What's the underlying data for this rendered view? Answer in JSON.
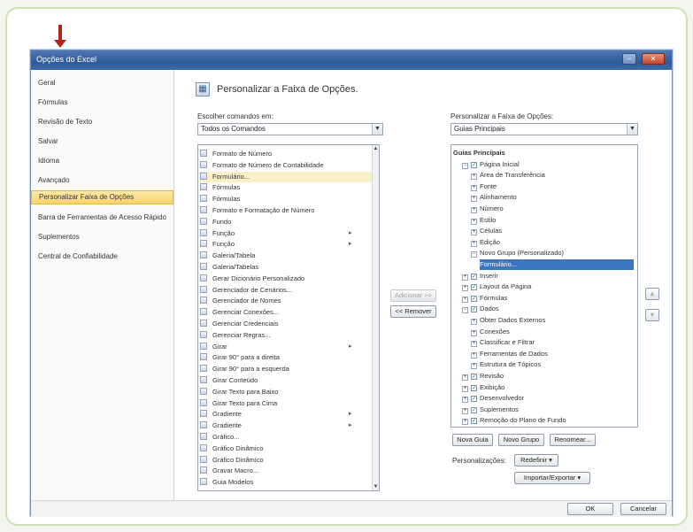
{
  "colors": {
    "frame_border": "#cfe0b4",
    "titlebar": "#2f5a98",
    "selection_highlight": "#fbd36a",
    "tree_selection": "#3c75c2",
    "annotation_arrow": "#b3261e"
  },
  "window": {
    "title": "Opções do Excel",
    "controls": [
      "minimize-icon",
      "maximize-icon",
      "close-icon"
    ]
  },
  "sidebar": {
    "items": [
      {
        "label": "Geral"
      },
      {
        "label": "Fórmulas"
      },
      {
        "label": "Revisão de Texto"
      },
      {
        "label": "Salvar"
      },
      {
        "label": "Idioma"
      },
      {
        "label": "Avançado"
      },
      {
        "label": "Personalizar Faixa de Opções",
        "selected": true
      },
      {
        "label": "Barra de Ferramentas de Acesso Rápido"
      },
      {
        "label": "Suplementos"
      },
      {
        "label": "Central de Confiabilidade"
      }
    ]
  },
  "header": {
    "title": "Personalizar a Faixa de Opções.",
    "icon": "customize-ribbon-icon"
  },
  "left_panel": {
    "choose_label": "Escolher comandos em:",
    "choose_value": "Todos os Comandos",
    "commands": [
      {
        "label": "Formato de Número",
        "sub": ""
      },
      {
        "label": "Formato de Número de Contabilidade",
        "sub": ""
      },
      {
        "label": "Formulário...",
        "selected": true,
        "sub": ""
      },
      {
        "label": "Fórmulas",
        "sub": ""
      },
      {
        "label": "Fórmulas",
        "sub": ""
      },
      {
        "label": "Formato e Formatação de Número",
        "sub": ""
      },
      {
        "label": "Fundo",
        "sub": ""
      },
      {
        "label": "Função",
        "sub": "▸"
      },
      {
        "label": "Função",
        "sub": "▸"
      },
      {
        "label": "Galeria/Tabela",
        "sub": ""
      },
      {
        "label": "Galeria/Tabelas",
        "sub": ""
      },
      {
        "label": "Gerar Dicionário Personalizado",
        "sub": ""
      },
      {
        "label": "Gerenciador de Cenários...",
        "sub": ""
      },
      {
        "label": "Gerenciador de Nomes",
        "sub": ""
      },
      {
        "label": "Gerenciar Conexões...",
        "sub": ""
      },
      {
        "label": "Gerenciar Credenciais",
        "sub": ""
      },
      {
        "label": "Gerenciar Regras...",
        "sub": ""
      },
      {
        "label": "Girar",
        "sub": "▸"
      },
      {
        "label": "Girar 90° para a direita",
        "sub": ""
      },
      {
        "label": "Girar 90° para a esquerda",
        "sub": ""
      },
      {
        "label": "Girar Conteúdo",
        "sub": ""
      },
      {
        "label": "Girar Texto para Baixo",
        "sub": ""
      },
      {
        "label": "Girar Texto para Cima",
        "sub": ""
      },
      {
        "label": "Gradiente",
        "sub": "▸"
      },
      {
        "label": "Gradiente",
        "sub": "▸"
      },
      {
        "label": "Gráfico...",
        "sub": ""
      },
      {
        "label": "Gráfico Dinâmico",
        "sub": ""
      },
      {
        "label": "Gráfico Dinâmico",
        "sub": ""
      },
      {
        "label": "Gravar Macro...",
        "sub": ""
      },
      {
        "label": "Guia Modelos",
        "sub": ""
      }
    ]
  },
  "middle_buttons": {
    "add": "Adicionar >>",
    "remove": "<< Remover"
  },
  "right_panel": {
    "customize_label": "Personalizar a Faixa de Opções:",
    "customize_value": "Guias Principais",
    "tree": [
      {
        "label": "Guias Principais",
        "level": 0,
        "bold": true,
        "toggle": "",
        "checkbox": false
      },
      {
        "label": "Página Inicial",
        "level": 1,
        "toggle": "−",
        "checkbox": true
      },
      {
        "label": "Área de Transferência",
        "level": 2,
        "toggle": "+",
        "checkbox": false
      },
      {
        "label": "Fonte",
        "level": 2,
        "toggle": "+",
        "checkbox": false
      },
      {
        "label": "Alinhamento",
        "level": 2,
        "toggle": "+",
        "checkbox": false
      },
      {
        "label": "Número",
        "level": 2,
        "toggle": "+",
        "checkbox": false
      },
      {
        "label": "Estilo",
        "level": 2,
        "toggle": "+",
        "checkbox": false
      },
      {
        "label": "Células",
        "level": 2,
        "toggle": "+",
        "checkbox": false
      },
      {
        "label": "Edição",
        "level": 2,
        "toggle": "+",
        "checkbox": false
      },
      {
        "label": "Novo Grupo (Personalizado)",
        "level": 2,
        "toggle": "−",
        "checkbox": false
      },
      {
        "label": "Formulário...",
        "level": 3,
        "toggle": "",
        "checkbox": false,
        "selected": true
      },
      {
        "label": "Inserir",
        "level": 1,
        "toggle": "+",
        "checkbox": true
      },
      {
        "label": "Layout da Página",
        "level": 1,
        "toggle": "+",
        "checkbox": true
      },
      {
        "label": "Fórmulas",
        "level": 1,
        "toggle": "+",
        "checkbox": true
      },
      {
        "label": "Dados",
        "level": 1,
        "toggle": "−",
        "checkbox": true
      },
      {
        "label": "Obter Dados Externos",
        "level": 2,
        "toggle": "+",
        "checkbox": false
      },
      {
        "label": "Conexões",
        "level": 2,
        "toggle": "+",
        "checkbox": false
      },
      {
        "label": "Classificar e Filtrar",
        "level": 2,
        "toggle": "+",
        "checkbox": false
      },
      {
        "label": "Ferramentas de Dados",
        "level": 2,
        "toggle": "+",
        "checkbox": false
      },
      {
        "label": "Estrutura de Tópicos",
        "level": 2,
        "toggle": "+",
        "checkbox": false
      },
      {
        "label": "Revisão",
        "level": 1,
        "toggle": "+",
        "checkbox": true
      },
      {
        "label": "Exibição",
        "level": 1,
        "toggle": "+",
        "checkbox": true
      },
      {
        "label": "Desenvolvedor",
        "level": 1,
        "toggle": "+",
        "checkbox": true
      },
      {
        "label": "Suplementos",
        "level": 1,
        "toggle": "+",
        "checkbox": true
      },
      {
        "label": "Remoção do Plano de Fundo",
        "level": 1,
        "toggle": "+",
        "checkbox": true
      }
    ],
    "new_tab": "Nova Guia",
    "new_group": "Novo Grupo",
    "rename": "Renomear...",
    "customizations_label": "Personalizações:",
    "reset": "Redefinir ▾",
    "import_export": "Importar/Exportar ▾"
  },
  "footer": {
    "ok": "OK",
    "cancel": "Cancelar"
  }
}
